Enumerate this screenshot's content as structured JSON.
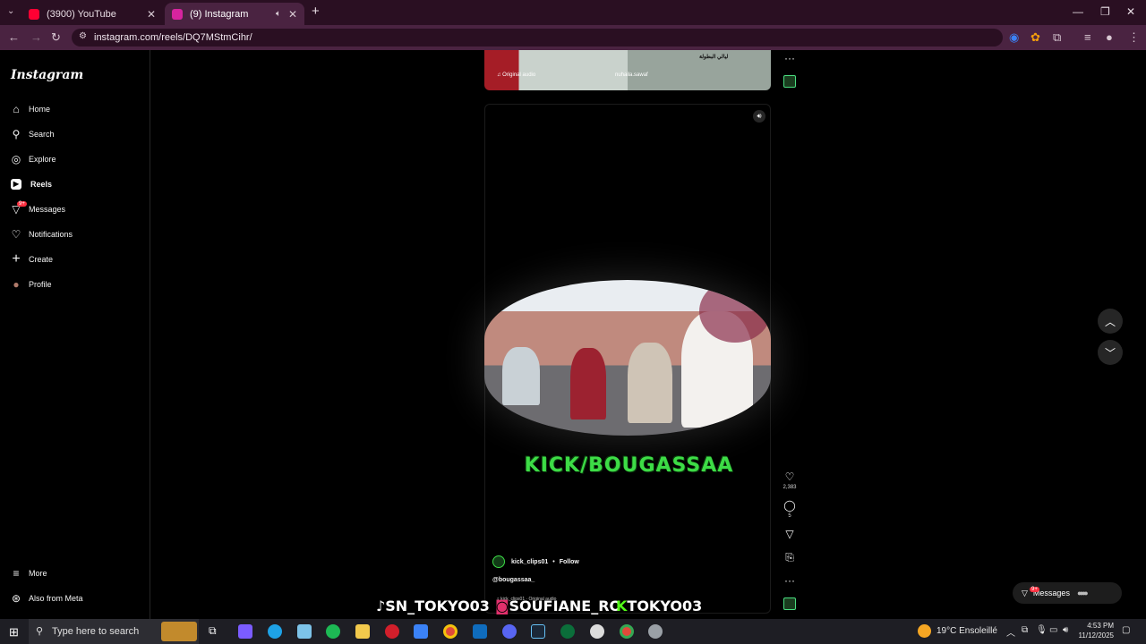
{
  "browser": {
    "tabs": [
      {
        "title": "(3900) YouTube",
        "fav_color": "#ff0033"
      },
      {
        "title": "(9) Instagram",
        "fav_color": "#d6249f",
        "active": true
      }
    ],
    "url": "instagram.com/reels/DQ7MStmCihr/"
  },
  "sidebar": {
    "logo": "Instagram",
    "items": [
      {
        "label": "Home",
        "icon": "home-icon",
        "glyph": "⌂"
      },
      {
        "label": "Search",
        "icon": "search-icon",
        "glyph": "⚲"
      },
      {
        "label": "Explore",
        "icon": "compass-icon",
        "glyph": "◎"
      },
      {
        "label": "Reels",
        "icon": "reels-icon",
        "glyph": "▶",
        "active": true
      },
      {
        "label": "Messages",
        "icon": "messenger-icon",
        "glyph": "▽",
        "badge": "9+"
      },
      {
        "label": "Notifications",
        "icon": "heart-icon",
        "glyph": "♡"
      },
      {
        "label": "Create",
        "icon": "plus-icon",
        "glyph": "+"
      },
      {
        "label": "Profile",
        "icon": "avatar",
        "glyph": "●"
      }
    ],
    "bottom": [
      {
        "label": "More",
        "icon": "menu-icon",
        "glyph": "≡"
      },
      {
        "label": "Also from Meta",
        "icon": "meta-icon",
        "glyph": "⊛"
      }
    ]
  },
  "previous_reel": {
    "audio": "Original audio",
    "user": "nuhaila.sawaf",
    "arabic_caption": "ليالي البطولة"
  },
  "current_reel": {
    "overlay_text": "KICK/BOUGASSAA",
    "username": "kick_clips01",
    "follow_label": "Follow",
    "caption": "@bougassaa_",
    "audio": "kick_clips01 · Original audio",
    "likes": "2,383",
    "comments": "5"
  },
  "messages_pill": {
    "label": "Messages",
    "badge": "9+"
  },
  "watermark": {
    "tiktok": "SN_TOKYO03",
    "instagram": "SOUFIANE_RO",
    "kick": "TOKYO03"
  },
  "taskbar": {
    "search_placeholder": "Type here to search",
    "weather": "19°C  Ensoleillé",
    "time": "4:53 PM",
    "date": "11/12/2025"
  }
}
